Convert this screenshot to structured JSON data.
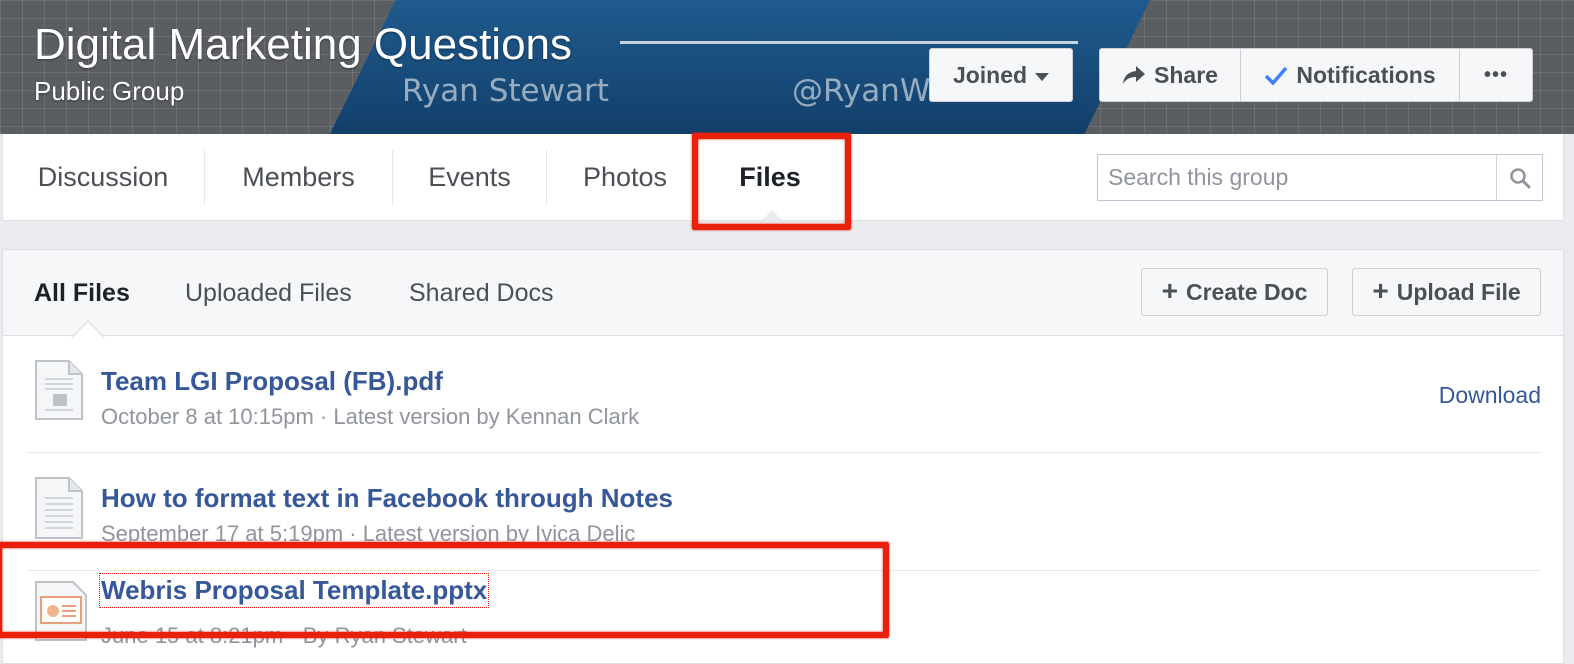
{
  "cover": {
    "title": "Digital Marketing Questions",
    "subtitle": "Public Group",
    "watermark_name": "Ryan Stewart",
    "watermark_handle": "@RyanW...",
    "joined_label": "Joined",
    "share_label": "Share",
    "notifications_label": "Notifications",
    "more_label": "•••"
  },
  "nav": {
    "tabs": [
      {
        "label": "Discussion"
      },
      {
        "label": "Members"
      },
      {
        "label": "Events"
      },
      {
        "label": "Photos"
      },
      {
        "label": "Files"
      }
    ],
    "active_tab": "Files",
    "search_placeholder": "Search this group"
  },
  "files": {
    "subtabs": [
      {
        "label": "All Files"
      },
      {
        "label": "Uploaded Files"
      },
      {
        "label": "Shared Docs"
      }
    ],
    "active_subtab": "All Files",
    "create_doc_label": "Create Doc",
    "upload_file_label": "Upload File",
    "items": [
      {
        "name": "Team LGI Proposal (FB).pdf",
        "meta": "October 8 at 10:15pm · Latest version by Kennan Clark",
        "action": "Download",
        "icon": "pdf-document-icon"
      },
      {
        "name": "How to format text in Facebook through Notes",
        "meta": "September 17 at 5:19pm · Latest version by Ivica Delic",
        "icon": "text-document-icon"
      },
      {
        "name": "Webris Proposal Template.pptx",
        "meta": "June 15 at 8:21pm · By Ryan Stewart",
        "icon": "presentation-document-icon"
      }
    ]
  },
  "colors": {
    "link": "#365899",
    "highlight": "#e8200c",
    "cover_band": "#1f5b8e"
  }
}
